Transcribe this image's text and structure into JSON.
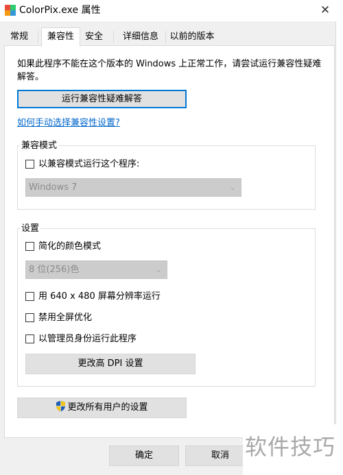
{
  "window": {
    "title": "ColorPix.exe 属性",
    "close_glyph": "✕"
  },
  "tabs": [
    {
      "label": "常规"
    },
    {
      "label": "兼容性",
      "active": true
    },
    {
      "label": "安全"
    },
    {
      "label": "详细信息"
    },
    {
      "label": "以前的版本"
    }
  ],
  "compat": {
    "intro": "如果此程序不能在这个版本的 Windows 上正常工作，请尝试运行兼容性疑难解答。",
    "troubleshoot_button": "运行兼容性疑难解答",
    "manual_link": "如何手动选择兼容性设置?"
  },
  "compat_mode": {
    "legend": "兼容模式",
    "checkbox_label": "以兼容模式运行这个程序:",
    "checked": false,
    "os_select_value": "Windows 7"
  },
  "settings": {
    "legend": "设置",
    "reduced_color": {
      "label": "简化的颜色模式",
      "checked": false
    },
    "color_select_value": "8 位(256)色",
    "res_640": {
      "label": "用 640 x 480 屏幕分辨率运行",
      "checked": false
    },
    "fullscreen_opt": {
      "label": "禁用全屏优化",
      "checked": false
    },
    "run_admin": {
      "label": "以管理员身份运行此程序",
      "checked": false
    },
    "dpi_button": "更改高 DPI 设置"
  },
  "all_users_button": "更改所有用户的设置",
  "footer": {
    "ok": "确定",
    "cancel": "取消"
  },
  "watermark": "软件技巧",
  "colors": {
    "link": "#0066cc",
    "focus_border": "#0078d7",
    "combo_disabled_bg": "#cccccc"
  },
  "icons": {
    "app": "colorpix-app-icon",
    "close": "close-icon",
    "dropdown": "chevron-down-icon",
    "uac": "uac-shield-icon"
  }
}
